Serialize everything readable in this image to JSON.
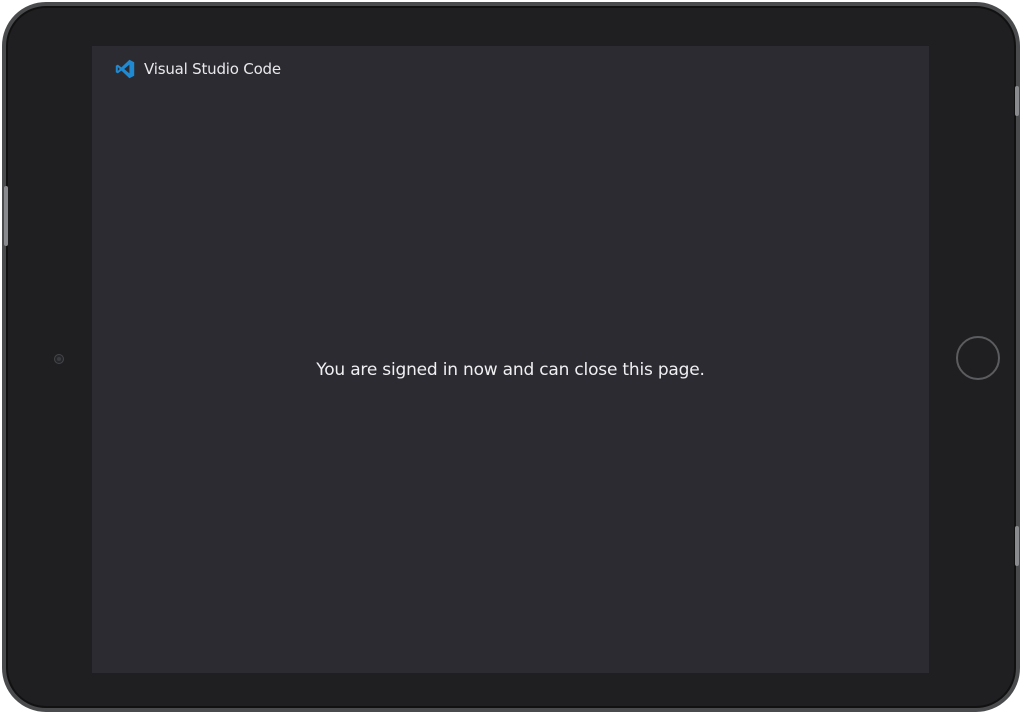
{
  "header": {
    "app_name": "Visual Studio Code",
    "logo_icon": "vscode-logo-icon",
    "logo_color": "#1f8ad2"
  },
  "main": {
    "message": "You are signed in now and can close this page."
  },
  "colors": {
    "screen_background": "#2c2b31",
    "device_frame": "#1f1f21",
    "text": "#f0f0f2"
  }
}
